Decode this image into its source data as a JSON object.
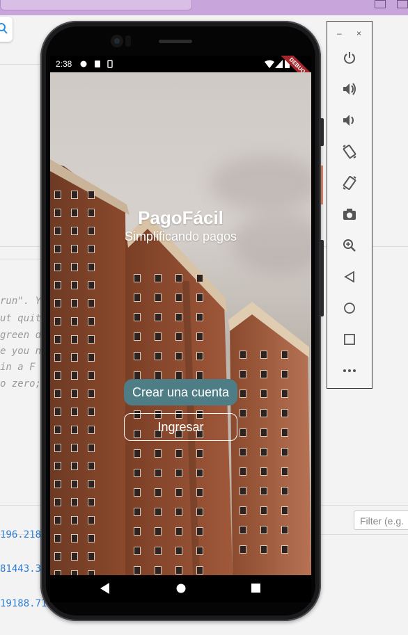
{
  "app": {
    "title": "PagoFácil",
    "subtitle": "Simplificando pagos",
    "primary_button": "Crear una cuenta",
    "secondary_button": "Ingresar",
    "primary_color": "#4e7d86"
  },
  "status_bar": {
    "time": "2:38",
    "debug_banner": "DEBUG"
  },
  "emulator_toolbar": {
    "minimize": "–",
    "close": "×",
    "items": [
      "power-icon",
      "volume-up-icon",
      "volume-down-icon",
      "rotate-left-icon",
      "rotate-right-icon",
      "camera-icon",
      "zoom-icon",
      "back-icon",
      "home-icon",
      "overview-icon",
      "more-icon"
    ]
  },
  "ide": {
    "code_lines": [
      "run\". Y",
      "ut quit",
      "green d",
      "e you n",
      "in a F",
      "o zero;"
    ],
    "log_numbers": [
      "196.218",
      "81443.3",
      "19188.71"
    ],
    "filter_placeholder": "Filter (e.g."
  }
}
